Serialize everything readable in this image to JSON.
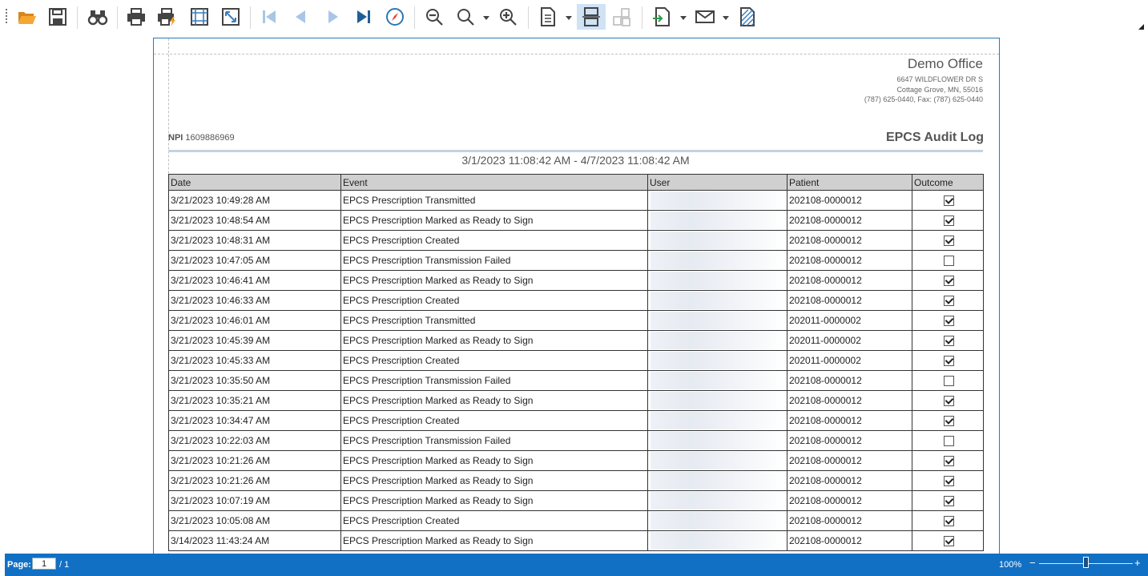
{
  "toolbar": {
    "buttons": [
      "open-folder-icon",
      "save-icon",
      "find-icon",
      "print-icon",
      "quick-print-icon",
      "page-setup-icon",
      "scale-icon",
      "first-page-icon",
      "previous-page-icon",
      "next-page-icon",
      "last-page-icon",
      "navigation-pane-icon",
      "zoom-out-icon",
      "zoom-icon",
      "zoom-in-icon",
      "page-layout-icon",
      "continuous-view-icon",
      "multiple-pages-icon",
      "export-icon",
      "email-icon",
      "watermark-icon"
    ]
  },
  "report": {
    "office_name": "Demo Office",
    "address_line1": "6647 WILDFLOWER DR S",
    "address_line2": "Cottage Grove, MN, 55016",
    "phone_line": "(787) 625-0440, Fax: (787) 625-0440",
    "npi_label": "NPI",
    "npi_value": "1609886969",
    "title": "EPCS Audit Log",
    "date_range": "3/1/2023 11:08:42 AM - 4/7/2023 11:08:42 AM",
    "columns": [
      "Date",
      "Event",
      "User",
      "Patient",
      "Outcome"
    ],
    "rows": [
      {
        "date": "3/21/2023 10:49:28 AM",
        "event": "EPCS Prescription Transmitted",
        "patient": "202108-0000012",
        "outcome": true
      },
      {
        "date": "3/21/2023 10:48:54 AM",
        "event": "EPCS Prescription Marked as Ready to Sign",
        "patient": "202108-0000012",
        "outcome": true
      },
      {
        "date": "3/21/2023 10:48:31 AM",
        "event": "EPCS Prescription Created",
        "patient": "202108-0000012",
        "outcome": true
      },
      {
        "date": "3/21/2023 10:47:05 AM",
        "event": "EPCS Prescription Transmission Failed",
        "patient": "202108-0000012",
        "outcome": false
      },
      {
        "date": "3/21/2023 10:46:41 AM",
        "event": "EPCS Prescription Marked as Ready to Sign",
        "patient": "202108-0000012",
        "outcome": true
      },
      {
        "date": "3/21/2023 10:46:33 AM",
        "event": "EPCS Prescription Created",
        "patient": "202108-0000012",
        "outcome": true
      },
      {
        "date": "3/21/2023 10:46:01 AM",
        "event": "EPCS Prescription Transmitted",
        "patient": "202011-0000002",
        "outcome": true
      },
      {
        "date": "3/21/2023 10:45:39 AM",
        "event": "EPCS Prescription Marked as Ready to Sign",
        "patient": "202011-0000002",
        "outcome": true
      },
      {
        "date": "3/21/2023 10:45:33 AM",
        "event": "EPCS Prescription Created",
        "patient": "202011-0000002",
        "outcome": true
      },
      {
        "date": "3/21/2023 10:35:50 AM",
        "event": "EPCS Prescription Transmission Failed",
        "patient": "202108-0000012",
        "outcome": false
      },
      {
        "date": "3/21/2023 10:35:21 AM",
        "event": "EPCS Prescription Marked as Ready to Sign",
        "patient": "202108-0000012",
        "outcome": true
      },
      {
        "date": "3/21/2023 10:34:47 AM",
        "event": "EPCS Prescription Created",
        "patient": "202108-0000012",
        "outcome": true
      },
      {
        "date": "3/21/2023 10:22:03 AM",
        "event": "EPCS Prescription Transmission Failed",
        "patient": "202108-0000012",
        "outcome": false
      },
      {
        "date": "3/21/2023 10:21:26 AM",
        "event": "EPCS Prescription Marked as Ready to Sign",
        "patient": "202108-0000012",
        "outcome": true
      },
      {
        "date": "3/21/2023 10:21:26 AM",
        "event": "EPCS Prescription Marked as Ready to Sign",
        "patient": "202108-0000012",
        "outcome": true
      },
      {
        "date": "3/21/2023 10:07:19 AM",
        "event": "EPCS Prescription Marked as Ready to Sign",
        "patient": "202108-0000012",
        "outcome": true
      },
      {
        "date": "3/21/2023 10:05:08 AM",
        "event": "EPCS Prescription Created",
        "patient": "202108-0000012",
        "outcome": true
      },
      {
        "date": "3/14/2023 11:43:24 AM",
        "event": "EPCS Prescription Marked as Ready to Sign",
        "patient": "202108-0000012",
        "outcome": true
      }
    ]
  },
  "statusbar": {
    "page_label": "Page:",
    "page_value": "1",
    "page_total": "/ 1",
    "zoom": "100%",
    "zoom_minus": "−",
    "zoom_plus": "+",
    "zoom_level": 0.47
  },
  "colors": {
    "statusbar": "#1170c4",
    "accent": "#2a79b8",
    "folder": "#f2a02b"
  }
}
